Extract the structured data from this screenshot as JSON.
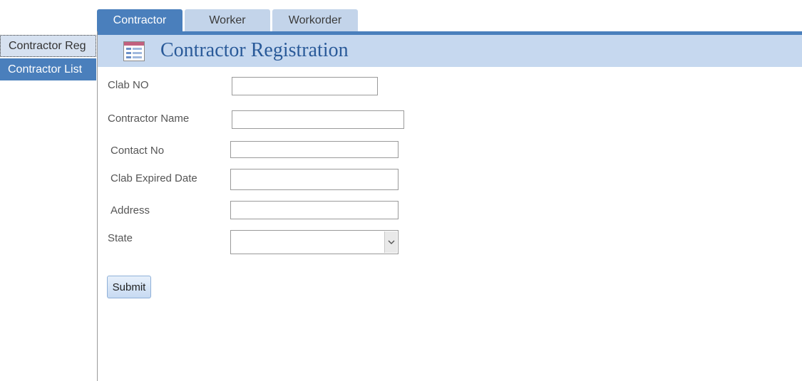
{
  "tabs": [
    {
      "label": "Contractor",
      "active": true
    },
    {
      "label": "Worker",
      "active": false
    },
    {
      "label": "Workorder",
      "active": false
    }
  ],
  "sidebar": {
    "items": [
      {
        "label": "Contractor Reg",
        "selected": true
      },
      {
        "label": "Contractor List",
        "selected": false
      }
    ]
  },
  "header": {
    "title": "Contractor Registration",
    "icon": "form-icon"
  },
  "form": {
    "clab_no": {
      "label": "Clab NO",
      "value": ""
    },
    "contractor_name": {
      "label": "Contractor Name",
      "value": ""
    },
    "contact_no": {
      "label": "Contact No",
      "value": ""
    },
    "clab_expired_date": {
      "label": "Clab Expired Date",
      "value": ""
    },
    "address": {
      "label": "Address",
      "value": ""
    },
    "state": {
      "label": "State",
      "value": ""
    },
    "submit_label": "Submit"
  },
  "colors": {
    "accent": "#4a7fbc",
    "tab_inactive": "#c3d4ea",
    "header_band": "#c6d8ef",
    "title_text": "#2a5a99"
  }
}
